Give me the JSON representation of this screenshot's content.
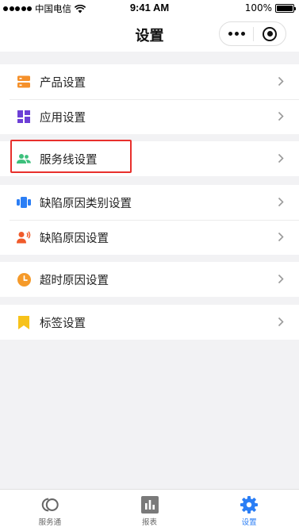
{
  "status_bar": {
    "carrier": "中国电信",
    "time": "9:41 AM",
    "battery": "100%"
  },
  "nav": {
    "title": "设置"
  },
  "menu_groups": [
    {
      "items": [
        {
          "label": "产品设置",
          "icon": "product-icon",
          "color": "#f5902a"
        },
        {
          "label": "应用设置",
          "icon": "apps-grid-icon",
          "color": "#6d3fd6"
        }
      ]
    },
    {
      "items": [
        {
          "label": "服务线设置",
          "icon": "people-icon",
          "color": "#3cc07c",
          "highlighted": true
        }
      ]
    },
    {
      "items": [
        {
          "label": "缺陷原因类别设置",
          "icon": "tags-icon",
          "color": "#2b7ef5"
        },
        {
          "label": "缺陷原因设置",
          "icon": "person-alert-icon",
          "color": "#f05a2a"
        }
      ]
    },
    {
      "items": [
        {
          "label": "超时原因设置",
          "icon": "clock-icon",
          "color": "#f59a2a"
        }
      ]
    },
    {
      "items": [
        {
          "label": "标签设置",
          "icon": "bookmark-icon",
          "color": "#f7c21a"
        }
      ]
    }
  ],
  "tabs": [
    {
      "label": "服务通",
      "icon": "service-ring-icon",
      "active": false
    },
    {
      "label": "报表",
      "icon": "bar-chart-icon",
      "active": false
    },
    {
      "label": "设置",
      "icon": "gear-icon",
      "active": true
    }
  ],
  "colors": {
    "accent": "#2b7ef5",
    "highlight_border": "#e8302c"
  }
}
